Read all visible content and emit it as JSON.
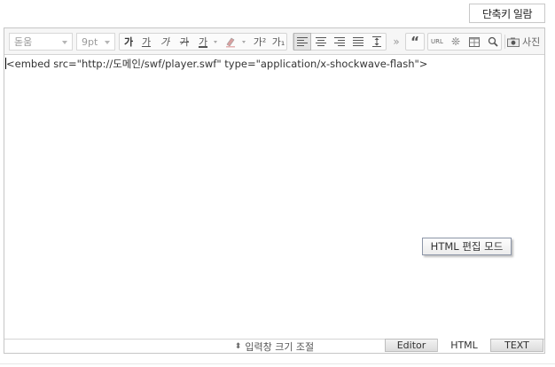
{
  "header": {
    "shortcut_button": "단축키 일람"
  },
  "toolbar": {
    "font_family": "돋움",
    "font_size": "9pt",
    "format_buttons": {
      "bold": "가",
      "underline": "가",
      "italic": "가",
      "strike": "가",
      "text_color": "가",
      "superscript": "가²",
      "subscript": "가₁"
    },
    "link_label": "URL",
    "photo_label": "사진",
    "more": "»",
    "quote": "“"
  },
  "editor": {
    "html_source": "<embed src=\"http://도메인/swf/player.swf\" type=\"application/x-shockwave-flash\">",
    "tooltip": "HTML 편집 모드"
  },
  "footer": {
    "resize_label": "입력창 크기 조절",
    "tabs": [
      "Editor",
      "HTML",
      "TEXT"
    ],
    "active_tab": "HTML"
  }
}
